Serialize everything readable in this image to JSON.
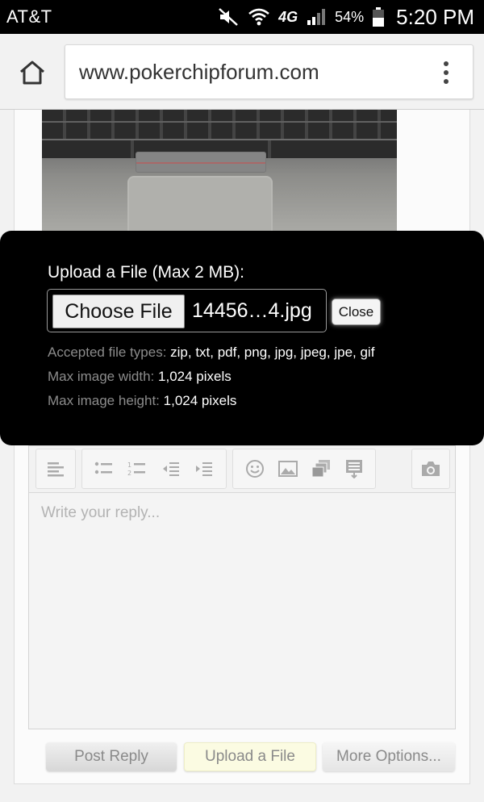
{
  "status_bar": {
    "carrier": "AT&T",
    "network": "4G",
    "battery": "54%",
    "time": "5:20 PM"
  },
  "browser": {
    "url": "www.pokerchipforum.com"
  },
  "upload_dialog": {
    "title": "Upload a File (Max 2 MB):",
    "choose_label": "Choose File",
    "file_name": "14456…4.jpg",
    "close_label": "Close",
    "accepted_label": "Accepted file types:",
    "accepted_value": "zip, txt, pdf, png, jpg, jpeg, jpe, gif",
    "width_label": "Max image width:",
    "width_value": "1,024 pixels",
    "height_label": "Max image height:",
    "height_value": "1,024 pixels"
  },
  "editor": {
    "placeholder": "Write your reply..."
  },
  "buttons": {
    "post_reply": "Post Reply",
    "upload_file": "Upload a File",
    "more_options": "More Options..."
  }
}
